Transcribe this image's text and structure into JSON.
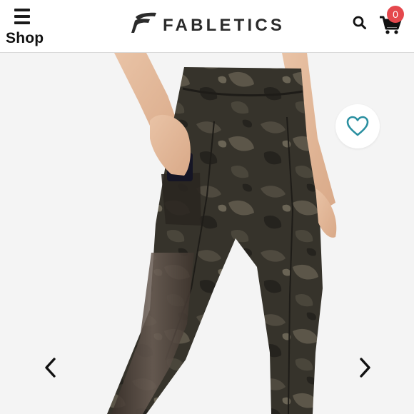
{
  "header": {
    "menu_label": "Shop",
    "brand_name": "FABLETICS",
    "cart_count": "0",
    "icons": [
      "menu-icon",
      "brand-logo-icon",
      "search-icon",
      "cart-icon"
    ]
  },
  "gallery": {
    "icons": [
      "heart-icon",
      "chevron-left-icon",
      "chevron-right-icon"
    ]
  },
  "colors": {
    "badge": "#e5484d",
    "wishlist_accent": "#2a8fa0",
    "text_dark": "#2b2b2b",
    "stage_bg": "#f4f4f4"
  }
}
